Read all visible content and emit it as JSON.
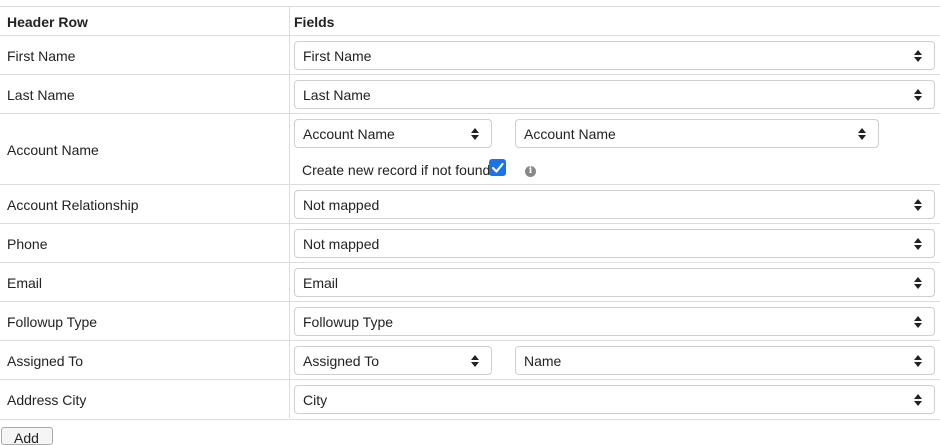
{
  "header": {
    "col1": "Header Row",
    "col2": "Fields"
  },
  "rows": [
    {
      "label": "First Name",
      "select": "First Name"
    },
    {
      "label": "Last Name",
      "select": "Last Name"
    },
    {
      "label": "Account Name",
      "select_a": "Account Name",
      "select_b": "Account Name",
      "checkbox_label": "Create new record if not found",
      "checkbox_checked": true
    },
    {
      "label": "Account Relationship",
      "select": "Not mapped"
    },
    {
      "label": "Phone",
      "select": "Not mapped"
    },
    {
      "label": "Email",
      "select": "Email"
    },
    {
      "label": "Followup Type",
      "select": "Followup Type"
    },
    {
      "label": "Assigned To",
      "select_a": "Assigned To",
      "select_b": "Name"
    },
    {
      "label": "Address City",
      "select": "City"
    }
  ],
  "add_button": "Add"
}
